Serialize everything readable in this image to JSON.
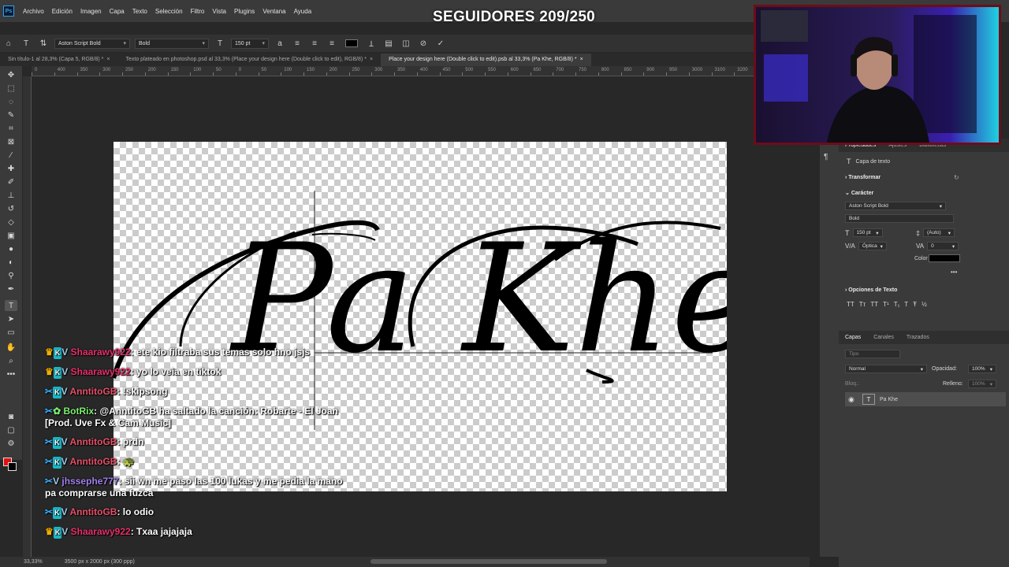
{
  "stream": {
    "title": "SEGUIDORES 209/250"
  },
  "menubar": {
    "logo": "Ps",
    "items": [
      "Archivo",
      "Edición",
      "Imagen",
      "Capa",
      "Texto",
      "Selección",
      "Filtro",
      "Vista",
      "Plugins",
      "Ventana",
      "Ayuda"
    ]
  },
  "options": {
    "font_family": "Aston Script Bold",
    "font_style": "Bold",
    "font_size": "150 pt"
  },
  "tabs": [
    {
      "label": "Sin título-1 al 28,3% (Capa 5, RGB/8) *",
      "close": "×"
    },
    {
      "label": "Texto plateado en photoshop.psd al 33,3% (Place your design here (Double click to edit), RGB/8) *",
      "close": "×"
    },
    {
      "label": "Place your design here (Double click to edit).psb al 33,3% (Pa Khe, RGB/8) *",
      "close": "×"
    }
  ],
  "ruler": {
    "labels": [
      "0",
      "400",
      "350",
      "300",
      "250",
      "200",
      "150",
      "100",
      "50",
      "0",
      "50",
      "100",
      "150",
      "200",
      "250",
      "300",
      "350",
      "400",
      "450",
      "500",
      "550",
      "600",
      "650",
      "700",
      "750",
      "800",
      "850",
      "900",
      "950",
      "3000",
      "3100",
      "3200"
    ]
  },
  "canvas": {
    "text": "Pa Khe"
  },
  "chat": [
    {
      "badge": "crown",
      "user": "Shaarawy922",
      "user_color": "#e8306a",
      "text": "ete kio filtraba sus temas solo hno jsjs"
    },
    {
      "badge": "crown",
      "user": "Shaarawy922",
      "user_color": "#e8306a",
      "text": "yo lo veia en tiktok"
    },
    {
      "badge": "wrench",
      "user": "AnntitoGB",
      "user_color": "#e8506a",
      "text": "!skipsong"
    },
    {
      "badge": "wrench-bot",
      "user": "BotRix",
      "user_color": "#7cf070",
      "text": "@AnntitoGB ha saltado la canción: Robarte - El Joan [Prod. Uve Fx & Cam Music]"
    },
    {
      "badge": "wrench",
      "user": "AnntitoGB",
      "user_color": "#e8506a",
      "text": "prdn"
    },
    {
      "badge": "wrench",
      "user": "AnntitoGB",
      "user_color": "#e8506a",
      "text": "🐢"
    },
    {
      "badge": "wrench-plain",
      "user": "jhssephe777",
      "user_color": "#a080f0",
      "text": "sii wn me paso las 100 lukas y me pedia la mano pa comprarse una fuzca"
    },
    {
      "badge": "wrench",
      "user": "AnntitoGB",
      "user_color": "#e8506a",
      "text": "lo odio"
    },
    {
      "badge": "crown",
      "user": "Shaarawy922",
      "user_color": "#e8306a",
      "text": "Txaa jajajaja"
    }
  ],
  "statusbar": {
    "zoom": "33,33%",
    "doc_info": "3500 px x 2000 px (300 ppp)"
  },
  "properties": {
    "tabs": [
      "Propiedades",
      "Ajustes",
      "Bibliotecas"
    ],
    "layer_type": "Capa de texto",
    "transform_label": "Transformar",
    "character_label": "Carácter",
    "font_family": "Aston Script Bold",
    "font_style": "Bold",
    "font_size": "150 pt",
    "leading": "(Auto)",
    "kerning": "Óptica",
    "tracking": "0",
    "color_label": "Color",
    "text_options_label": "Opciones de Texto",
    "more": "•••"
  },
  "layers": {
    "tabs": [
      "Capas",
      "Canales",
      "Trazados"
    ],
    "search_placeholder": "Tipo",
    "blend_mode": "Normal",
    "opacity_label": "Opacidad:",
    "opacity_value": "100%",
    "lock_label": "Bloq.:",
    "fill_label": "Relleno:",
    "fill_value": "100%",
    "layer_name": "Pa Khe"
  }
}
